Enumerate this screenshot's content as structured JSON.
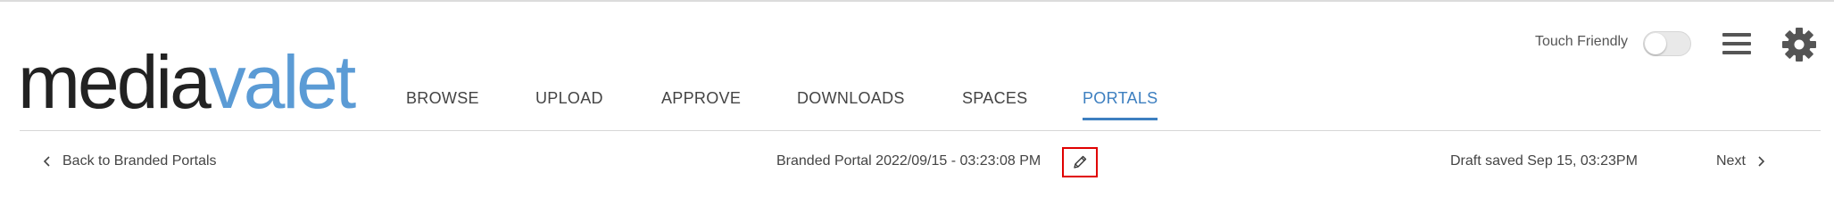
{
  "brand": {
    "logo_dark": "media",
    "logo_blue": "valet",
    "logo_dark_color": "#222222",
    "logo_blue_color": "#5b9bd5"
  },
  "nav": {
    "items": [
      {
        "label": "BROWSE",
        "active": false
      },
      {
        "label": "UPLOAD",
        "active": false
      },
      {
        "label": "APPROVE",
        "active": false
      },
      {
        "label": "DOWNLOADS",
        "active": false
      },
      {
        "label": "SPACES",
        "active": false
      },
      {
        "label": "PORTALS",
        "active": true
      }
    ],
    "active_color": "#3d7fc0"
  },
  "header": {
    "touch_friendly_label": "Touch Friendly",
    "touch_friendly_enabled": false,
    "menu_icon": "hamburger-icon",
    "settings_icon": "gear-icon"
  },
  "subbar": {
    "back_label": "Back to Branded Portals",
    "portal_title": "Branded Portal 2022/09/15 - 03:23:08 PM",
    "edit_icon": "pencil-icon",
    "draft_status": "Draft saved Sep 15, 03:23PM",
    "next_label": "Next"
  }
}
